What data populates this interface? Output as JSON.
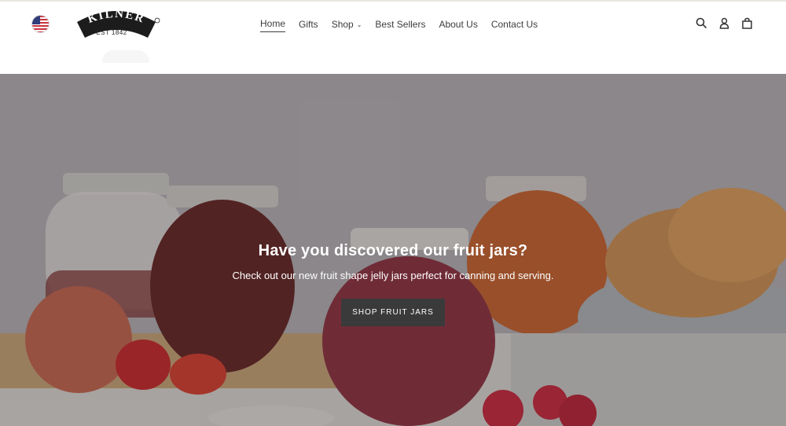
{
  "header": {
    "logo_text": "KILNER",
    "logo_sub": "EST 1842",
    "flag_icon": "us-flag-icon",
    "nav": [
      {
        "label": "Home",
        "active": true
      },
      {
        "label": "Gifts"
      },
      {
        "label": "Shop",
        "has_dropdown": true
      },
      {
        "label": "Best Sellers"
      },
      {
        "label": "About Us"
      },
      {
        "label": "Contact Us"
      }
    ],
    "icons": [
      "search-icon",
      "account-icon",
      "cart-icon"
    ]
  },
  "hero": {
    "title": "Have you discovered our fruit jars?",
    "subtitle": "Check out our new fruit shape jelly jars perfect for canning and serving.",
    "button_label": "SHOP FRUIT JARS"
  },
  "colors": {
    "text": "#3d3d3d",
    "button_bg": "#3a3a3a",
    "button_text": "#ffffff"
  }
}
